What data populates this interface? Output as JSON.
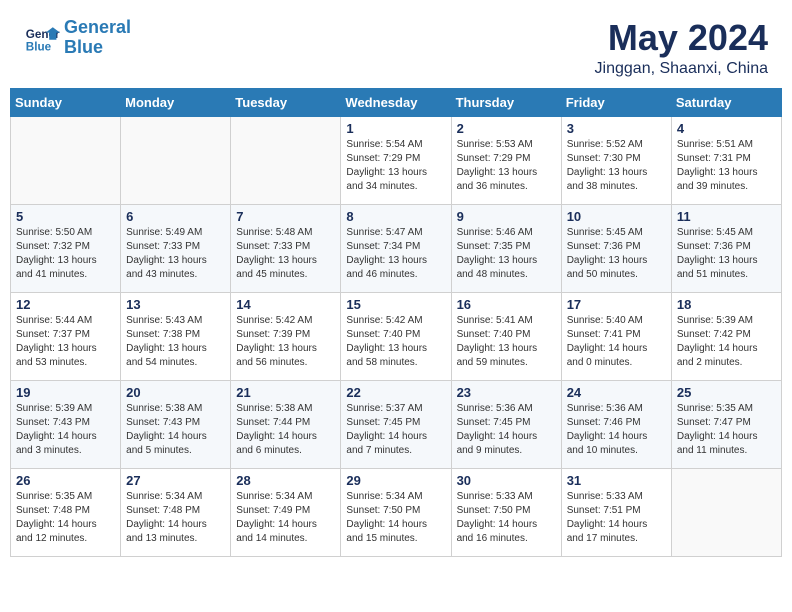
{
  "header": {
    "logo_line1": "General",
    "logo_line2": "Blue",
    "title": "May 2024",
    "subtitle": "Jinggan, Shaanxi, China"
  },
  "weekdays": [
    "Sunday",
    "Monday",
    "Tuesday",
    "Wednesday",
    "Thursday",
    "Friday",
    "Saturday"
  ],
  "weeks": [
    [
      {
        "day": "",
        "sunrise": "",
        "sunset": "",
        "daylight": ""
      },
      {
        "day": "",
        "sunrise": "",
        "sunset": "",
        "daylight": ""
      },
      {
        "day": "",
        "sunrise": "",
        "sunset": "",
        "daylight": ""
      },
      {
        "day": "1",
        "sunrise": "Sunrise: 5:54 AM",
        "sunset": "Sunset: 7:29 PM",
        "daylight": "Daylight: 13 hours and 34 minutes."
      },
      {
        "day": "2",
        "sunrise": "Sunrise: 5:53 AM",
        "sunset": "Sunset: 7:29 PM",
        "daylight": "Daylight: 13 hours and 36 minutes."
      },
      {
        "day": "3",
        "sunrise": "Sunrise: 5:52 AM",
        "sunset": "Sunset: 7:30 PM",
        "daylight": "Daylight: 13 hours and 38 minutes."
      },
      {
        "day": "4",
        "sunrise": "Sunrise: 5:51 AM",
        "sunset": "Sunset: 7:31 PM",
        "daylight": "Daylight: 13 hours and 39 minutes."
      }
    ],
    [
      {
        "day": "5",
        "sunrise": "Sunrise: 5:50 AM",
        "sunset": "Sunset: 7:32 PM",
        "daylight": "Daylight: 13 hours and 41 minutes."
      },
      {
        "day": "6",
        "sunrise": "Sunrise: 5:49 AM",
        "sunset": "Sunset: 7:33 PM",
        "daylight": "Daylight: 13 hours and 43 minutes."
      },
      {
        "day": "7",
        "sunrise": "Sunrise: 5:48 AM",
        "sunset": "Sunset: 7:33 PM",
        "daylight": "Daylight: 13 hours and 45 minutes."
      },
      {
        "day": "8",
        "sunrise": "Sunrise: 5:47 AM",
        "sunset": "Sunset: 7:34 PM",
        "daylight": "Daylight: 13 hours and 46 minutes."
      },
      {
        "day": "9",
        "sunrise": "Sunrise: 5:46 AM",
        "sunset": "Sunset: 7:35 PM",
        "daylight": "Daylight: 13 hours and 48 minutes."
      },
      {
        "day": "10",
        "sunrise": "Sunrise: 5:45 AM",
        "sunset": "Sunset: 7:36 PM",
        "daylight": "Daylight: 13 hours and 50 minutes."
      },
      {
        "day": "11",
        "sunrise": "Sunrise: 5:45 AM",
        "sunset": "Sunset: 7:36 PM",
        "daylight": "Daylight: 13 hours and 51 minutes."
      }
    ],
    [
      {
        "day": "12",
        "sunrise": "Sunrise: 5:44 AM",
        "sunset": "Sunset: 7:37 PM",
        "daylight": "Daylight: 13 hours and 53 minutes."
      },
      {
        "day": "13",
        "sunrise": "Sunrise: 5:43 AM",
        "sunset": "Sunset: 7:38 PM",
        "daylight": "Daylight: 13 hours and 54 minutes."
      },
      {
        "day": "14",
        "sunrise": "Sunrise: 5:42 AM",
        "sunset": "Sunset: 7:39 PM",
        "daylight": "Daylight: 13 hours and 56 minutes."
      },
      {
        "day": "15",
        "sunrise": "Sunrise: 5:42 AM",
        "sunset": "Sunset: 7:40 PM",
        "daylight": "Daylight: 13 hours and 58 minutes."
      },
      {
        "day": "16",
        "sunrise": "Sunrise: 5:41 AM",
        "sunset": "Sunset: 7:40 PM",
        "daylight": "Daylight: 13 hours and 59 minutes."
      },
      {
        "day": "17",
        "sunrise": "Sunrise: 5:40 AM",
        "sunset": "Sunset: 7:41 PM",
        "daylight": "Daylight: 14 hours and 0 minutes."
      },
      {
        "day": "18",
        "sunrise": "Sunrise: 5:39 AM",
        "sunset": "Sunset: 7:42 PM",
        "daylight": "Daylight: 14 hours and 2 minutes."
      }
    ],
    [
      {
        "day": "19",
        "sunrise": "Sunrise: 5:39 AM",
        "sunset": "Sunset: 7:43 PM",
        "daylight": "Daylight: 14 hours and 3 minutes."
      },
      {
        "day": "20",
        "sunrise": "Sunrise: 5:38 AM",
        "sunset": "Sunset: 7:43 PM",
        "daylight": "Daylight: 14 hours and 5 minutes."
      },
      {
        "day": "21",
        "sunrise": "Sunrise: 5:38 AM",
        "sunset": "Sunset: 7:44 PM",
        "daylight": "Daylight: 14 hours and 6 minutes."
      },
      {
        "day": "22",
        "sunrise": "Sunrise: 5:37 AM",
        "sunset": "Sunset: 7:45 PM",
        "daylight": "Daylight: 14 hours and 7 minutes."
      },
      {
        "day": "23",
        "sunrise": "Sunrise: 5:36 AM",
        "sunset": "Sunset: 7:45 PM",
        "daylight": "Daylight: 14 hours and 9 minutes."
      },
      {
        "day": "24",
        "sunrise": "Sunrise: 5:36 AM",
        "sunset": "Sunset: 7:46 PM",
        "daylight": "Daylight: 14 hours and 10 minutes."
      },
      {
        "day": "25",
        "sunrise": "Sunrise: 5:35 AM",
        "sunset": "Sunset: 7:47 PM",
        "daylight": "Daylight: 14 hours and 11 minutes."
      }
    ],
    [
      {
        "day": "26",
        "sunrise": "Sunrise: 5:35 AM",
        "sunset": "Sunset: 7:48 PM",
        "daylight": "Daylight: 14 hours and 12 minutes."
      },
      {
        "day": "27",
        "sunrise": "Sunrise: 5:34 AM",
        "sunset": "Sunset: 7:48 PM",
        "daylight": "Daylight: 14 hours and 13 minutes."
      },
      {
        "day": "28",
        "sunrise": "Sunrise: 5:34 AM",
        "sunset": "Sunset: 7:49 PM",
        "daylight": "Daylight: 14 hours and 14 minutes."
      },
      {
        "day": "29",
        "sunrise": "Sunrise: 5:34 AM",
        "sunset": "Sunset: 7:50 PM",
        "daylight": "Daylight: 14 hours and 15 minutes."
      },
      {
        "day": "30",
        "sunrise": "Sunrise: 5:33 AM",
        "sunset": "Sunset: 7:50 PM",
        "daylight": "Daylight: 14 hours and 16 minutes."
      },
      {
        "day": "31",
        "sunrise": "Sunrise: 5:33 AM",
        "sunset": "Sunset: 7:51 PM",
        "daylight": "Daylight: 14 hours and 17 minutes."
      },
      {
        "day": "",
        "sunrise": "",
        "sunset": "",
        "daylight": ""
      }
    ]
  ]
}
